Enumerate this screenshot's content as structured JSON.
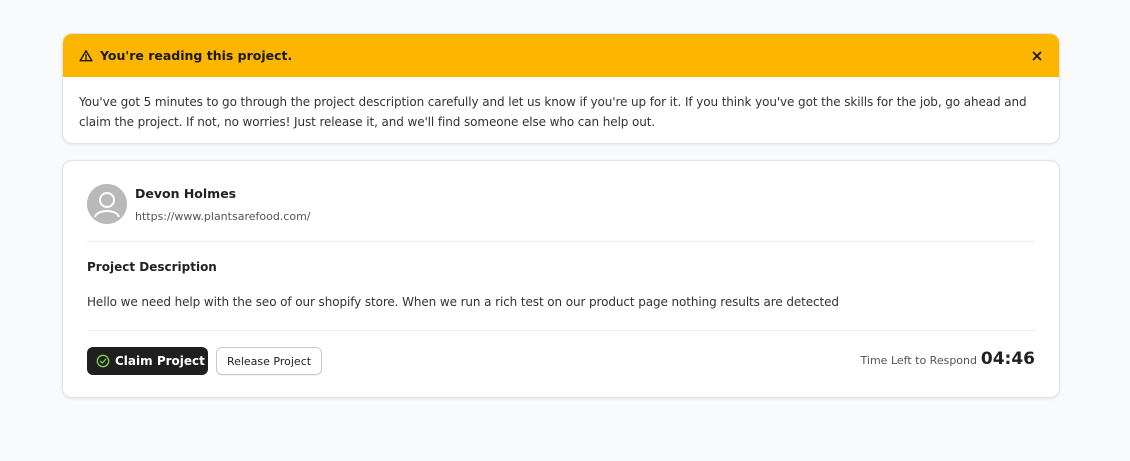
{
  "alert": {
    "icon": "warning-triangle-icon",
    "title": "You're reading this project.",
    "close_icon": "close-icon",
    "message": "You've got 5 minutes to go through the project description carefully and let us know if you're up for it. If you think you've got the skills for the job, go ahead and claim the project. If not, no worries! Just release it, and we'll find someone else who can help out.",
    "accent_color": "#fcb600"
  },
  "client": {
    "name": "Devon Holmes",
    "url": "https://www.plantsarefood.com/",
    "avatar_icon": "user-avatar-icon"
  },
  "project": {
    "section_title": "Project Description",
    "description": "Hello we need help with the seo of our shopify store. When we run a rich test on our product page nothing results are detected"
  },
  "actions": {
    "claim_label": "Claim Project",
    "claim_icon": "check-circle-icon",
    "release_label": "Release Project"
  },
  "timer": {
    "label": "Time Left to Respond",
    "value": "04:46"
  }
}
